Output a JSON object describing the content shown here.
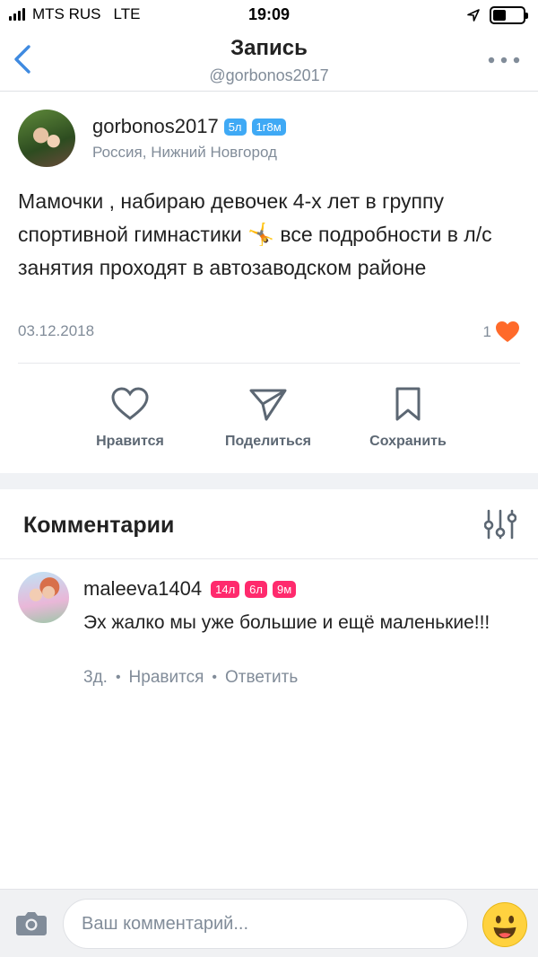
{
  "status_bar": {
    "carrier": "MTS RUS",
    "network": "LTE",
    "time": "19:09"
  },
  "nav": {
    "title": "Запись",
    "subtitle": "@gorbonos2017",
    "back_icon": "chevron-left-icon",
    "more_icon": "more-dots-icon"
  },
  "post": {
    "author": "gorbonos2017",
    "badges": [
      "5л",
      "1г8м"
    ],
    "location": "Россия, Нижний Новгород",
    "text_before_emoji": "Мамочки , набираю девочек 4-х лет в группу спортивной гимнастики",
    "emoji": "🤸",
    "text_after_emoji": " все подробности в л/с занятия проходят в автозаводском районе",
    "date": "03.12.2018",
    "likes": "1"
  },
  "actions": {
    "like_label": "Нравится",
    "share_label": "Поделиться",
    "save_label": "Сохранить"
  },
  "comments": {
    "title": "Комментарии",
    "items": [
      {
        "author": "maleeva1404",
        "badges": [
          "14л",
          "6л",
          "9м"
        ],
        "text": "Эх жалко мы уже большие и ещё маленькие!!!",
        "time": "3д.",
        "like_label": "Нравится",
        "reply_label": "Ответить"
      }
    ]
  },
  "composer": {
    "placeholder": "Ваш комментарий..."
  },
  "colors": {
    "accent_blue": "#3fa9f5",
    "accent_pink": "#ff2a6d",
    "like_orange": "#ff6a2a",
    "text_secondary": "#818c99"
  }
}
